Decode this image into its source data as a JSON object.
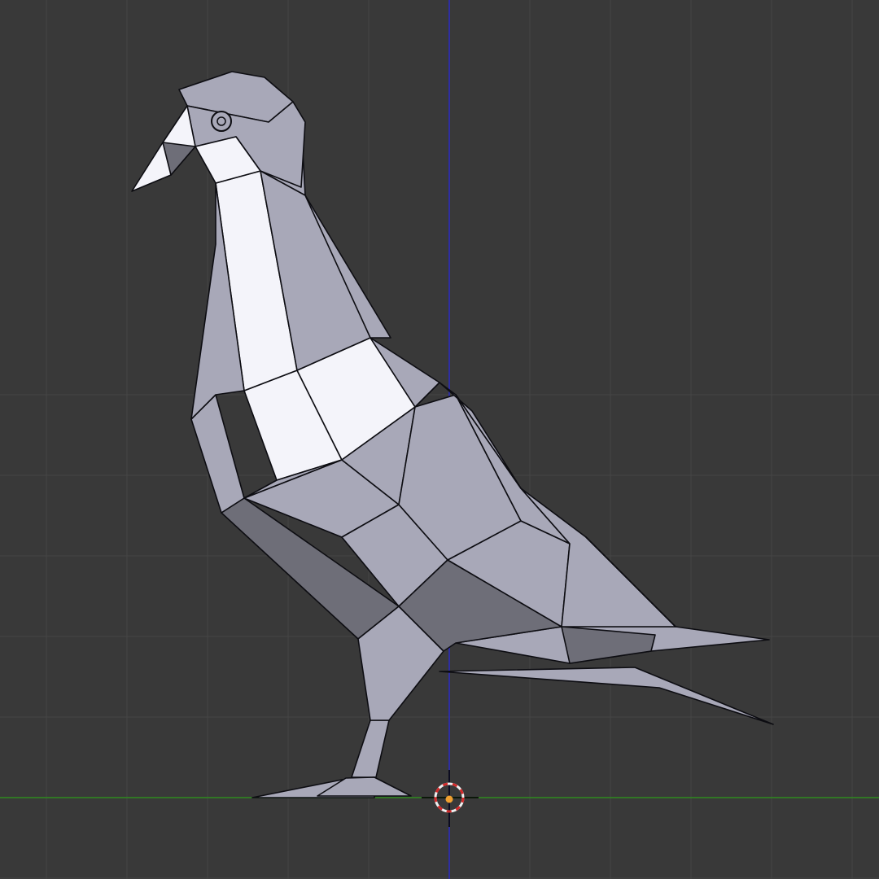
{
  "viewport": {
    "background_color": "#393939",
    "grid_color": "#454545",
    "x_axis_color": "#2f8a1f",
    "z_axis_color": "#2a2ac4",
    "mesh_edge_color": "#0d0d12",
    "mesh_light_color": "#f4f4fa",
    "mesh_mid_color": "#a8a8b8",
    "mesh_dark_color": "#6e6e78",
    "cursor_ring_color_a": "#d22a2a",
    "cursor_ring_color_b": "#f0f0f0",
    "origin_dot_color": "#f0a030"
  },
  "scene": {
    "object": "low-poly-pigeon-mesh",
    "view": "side",
    "show_grid": true,
    "show_axes": [
      "x",
      "z"
    ],
    "has_3d_cursor": true
  }
}
